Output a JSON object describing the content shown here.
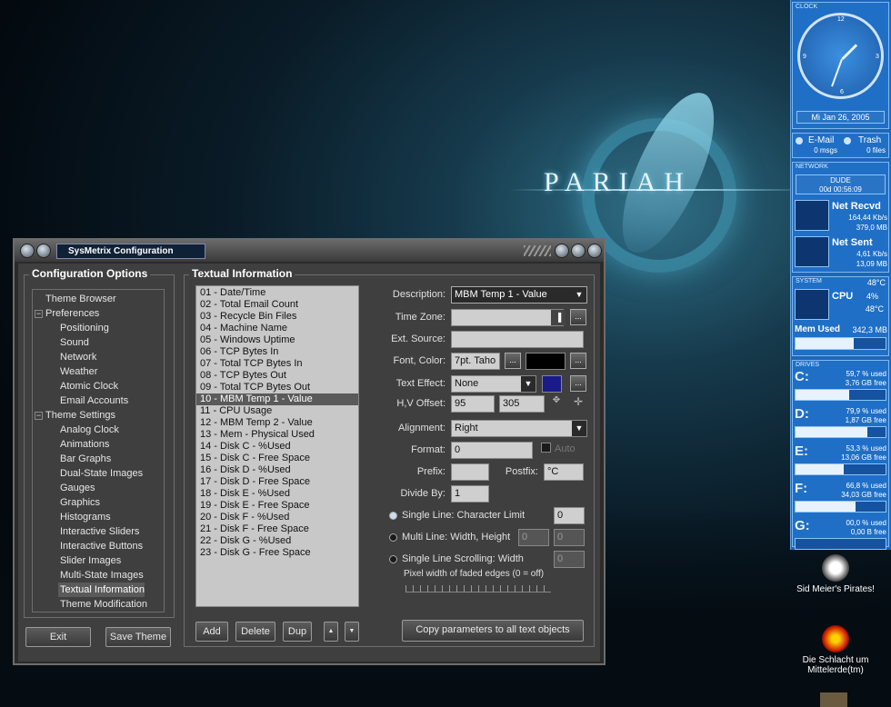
{
  "desktop": {
    "logo": "PARIAH",
    "icons": [
      {
        "label": "Sid Meier's Pirates!"
      },
      {
        "label": "Die Schlacht um Mittelerde(tm)"
      }
    ]
  },
  "sidebar": {
    "clock_title": "CLOCK",
    "clock_numbers": [
      "12",
      "3",
      "6",
      "9"
    ],
    "date": "Mi Jan 26, 2005",
    "email": {
      "label": "E-Mail",
      "value": "0 msgs"
    },
    "trash": {
      "label": "Trash",
      "value": "0 files"
    },
    "network_title": "NETWORK",
    "host": "DUDE",
    "uptime": "00d 00:56:09",
    "net_recvd": {
      "label": "Net Recvd",
      "rate": "164,44 Kb/s",
      "total": "379,0 MB"
    },
    "net_sent": {
      "label": "Net Sent",
      "rate": "4,61 Kb/s",
      "total": "13,09 MB"
    },
    "system_title": "SYSTEM",
    "system_temp": "48°C",
    "cpu": {
      "label": "CPU",
      "pct": "4%",
      "temp": "48°C"
    },
    "mem": {
      "label": "Mem Used",
      "value": "342,3 MB",
      "fill": 0.65
    },
    "drives_title": "DRIVES",
    "drives": [
      {
        "letter": "C:",
        "used": "59,7 % used",
        "free": "3,76 GB free",
        "fill": 0.597
      },
      {
        "letter": "D:",
        "used": "79,9 % used",
        "free": "1,87 GB free",
        "fill": 0.799
      },
      {
        "letter": "E:",
        "used": "53,3 % used",
        "free": "13,06 GB free",
        "fill": 0.533
      },
      {
        "letter": "F:",
        "used": "66,8 % used",
        "free": "34,03 GB free",
        "fill": 0.668
      },
      {
        "letter": "G:",
        "used": "00,0 % used",
        "free": "0,00 B free",
        "fill": 0.0
      }
    ]
  },
  "window": {
    "title": "SysMetrix Configuration",
    "config_header": "Configuration Options",
    "tree": [
      {
        "label": "Theme Browser"
      },
      {
        "label": "Preferences",
        "exp": "−"
      },
      {
        "label": "Positioning"
      },
      {
        "label": "Sound"
      },
      {
        "label": "Network"
      },
      {
        "label": "Weather"
      },
      {
        "label": "Atomic Clock"
      },
      {
        "label": "Email Accounts"
      },
      {
        "label": "Theme Settings",
        "exp": "−"
      },
      {
        "label": "Analog Clock"
      },
      {
        "label": "Animations"
      },
      {
        "label": "Bar Graphs"
      },
      {
        "label": "Dual-State Images"
      },
      {
        "label": "Gauges"
      },
      {
        "label": "Graphics"
      },
      {
        "label": "Histograms"
      },
      {
        "label": "Interactive Sliders"
      },
      {
        "label": "Interactive Buttons"
      },
      {
        "label": "Slider Images"
      },
      {
        "label": "Multi-State Images"
      },
      {
        "label": "Textual Information",
        "selected": true
      },
      {
        "label": "Theme Modification"
      }
    ],
    "exit_label": "Exit",
    "save_label": "Save Theme",
    "text_header": "Textual Information",
    "items": [
      "01 - Date/Time",
      "02 - Total Email Count",
      "03 - Recycle Bin Files",
      "04 - Machine Name",
      "05 - Windows Uptime",
      "06 - TCP Bytes In",
      "07 - Total TCP Bytes In",
      "08 - TCP Bytes Out",
      "09 - Total TCP Bytes Out",
      "10 - MBM Temp 1 - Value",
      "11 - CPU Usage",
      "12 - MBM Temp 2 - Value",
      "13 - Mem - Physical Used",
      "14 - Disk C - %Used",
      "15 - Disk C - Free Space",
      "16 - Disk D - %Used",
      "17 - Disk D - Free Space",
      "18 - Disk E - %Used",
      "19 - Disk E - Free Space",
      "20 - Disk F - %Used",
      "21 - Disk F - Free Space",
      "22 - Disk G - %Used",
      "23 - Disk G - Free Space"
    ],
    "selected_item": "10 - MBM Temp 1 - Value",
    "add_label": "Add",
    "delete_label": "Delete",
    "dup_label": "Dup",
    "up_glyph": "▲",
    "down_glyph": "▼",
    "fields": {
      "description_label": "Description:",
      "description_value": "MBM Temp 1 - Value",
      "timezone_label": "Time Zone:",
      "timezone_value": "",
      "extsource_label": "Ext. Source:",
      "extsource_value": "",
      "font_label": "Font, Color:",
      "font_value": "7pt. Taho",
      "font_color": "#000000",
      "effect_label": "Text Effect:",
      "effect_value": "None",
      "effect_color": "#1a1a8a",
      "offset_label": "H,V Offset:",
      "h_offset": "95",
      "v_offset": "305",
      "align_label": "Alignment:",
      "align_value": "Right",
      "format_label": "Format:",
      "format_value": "0",
      "auto_label": "Auto",
      "prefix_label": "Prefix:",
      "prefix_value": "",
      "postfix_label": "Postfix:",
      "postfix_value": "°C",
      "divide_label": "Divide By:",
      "divide_value": "1",
      "single_line_label": "Single Line: Character Limit",
      "single_line_value": "0",
      "multi_line_label": "Multi Line: Width, Height",
      "multi_w": "0",
      "multi_h": "0",
      "scroll_label": "Single Line Scrolling: Width",
      "scroll_value": "0",
      "pixel_label": "Pixel width of faded edges (0 = off)",
      "ellipsis": "...",
      "copy_label": "Copy parameters to all text objects"
    }
  }
}
